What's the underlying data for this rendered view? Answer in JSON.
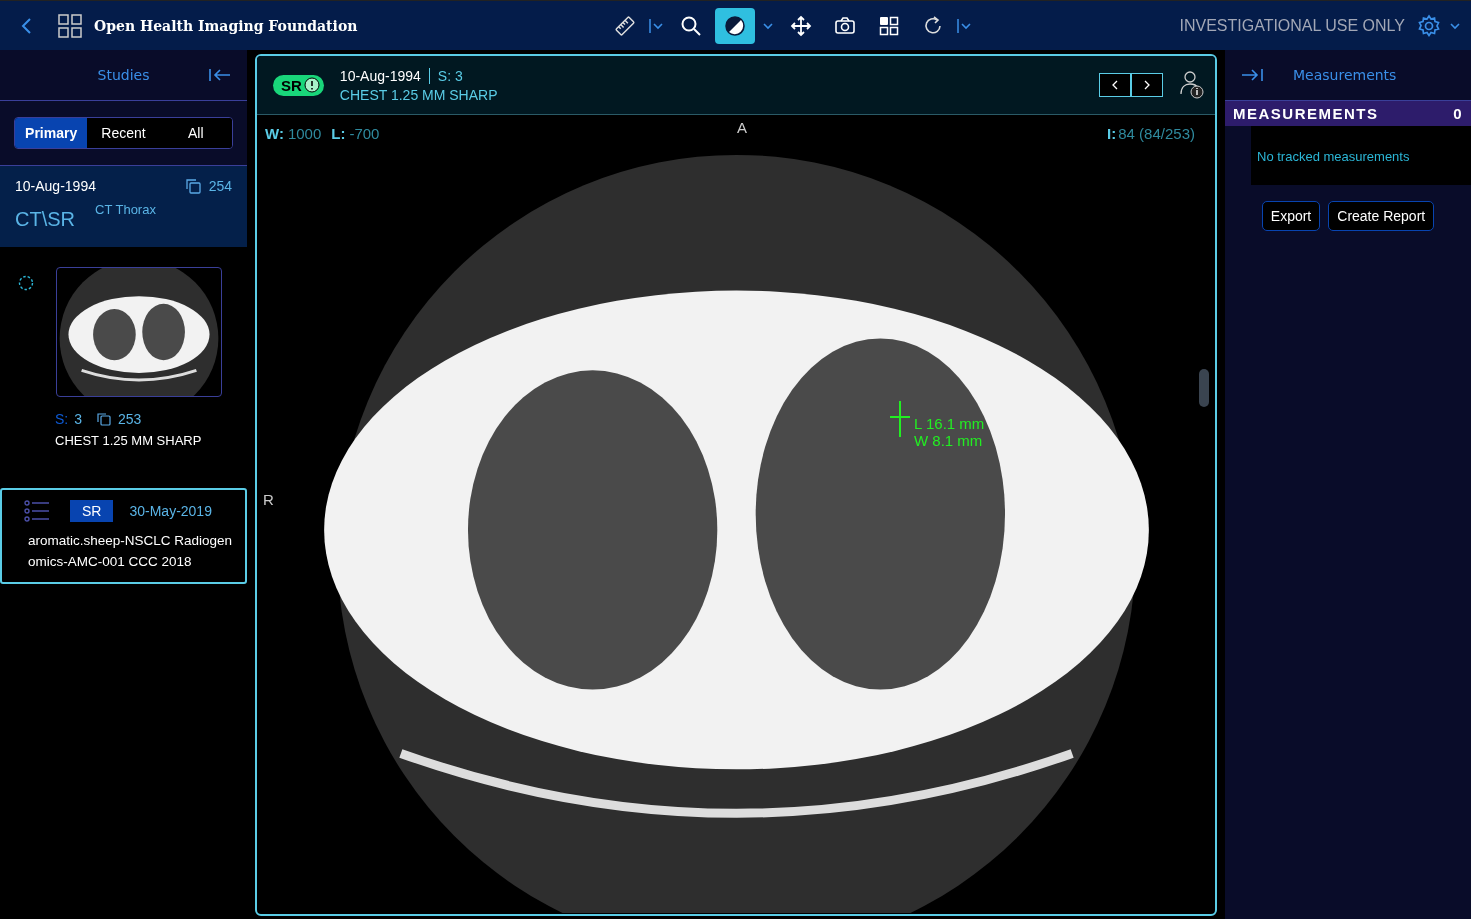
{
  "header": {
    "title": "Open Health Imaging Foundation",
    "notice": "INVESTIGATIONAL USE ONLY",
    "tools": [
      {
        "kind": "ruler",
        "selected": false,
        "dropdown": true
      },
      {
        "kind": "zoom",
        "selected": false,
        "dropdown": false
      },
      {
        "kind": "contrast",
        "selected": true,
        "dropdown": true
      },
      {
        "kind": "pan",
        "selected": false,
        "dropdown": false
      },
      {
        "kind": "camera",
        "selected": false,
        "dropdown": false
      },
      {
        "kind": "layout",
        "selected": false,
        "dropdown": false
      },
      {
        "kind": "rotate",
        "selected": false,
        "dropdown": true
      }
    ]
  },
  "studies_panel": {
    "title": "Studies",
    "tabs": [
      {
        "label": "Primary",
        "selected": true
      },
      {
        "label": "Recent",
        "selected": false
      },
      {
        "label": "All",
        "selected": false
      }
    ],
    "study": {
      "date": "10-Aug-1994",
      "instances": "254",
      "modality": "CT\\SR",
      "description": "CT Thorax"
    },
    "series": [
      {
        "kind": "image",
        "loading": true,
        "selected": false,
        "series_label": "S:",
        "series_number": "3",
        "instances": "253",
        "description": "CHEST 1.25 MM SHARP"
      },
      {
        "kind": "report",
        "selected": true,
        "badge": "SR",
        "date": "30-May-2019",
        "description": "aromatic.sheep-NSCLC Radiogenomics-AMC-001 CCC 2018"
      }
    ]
  },
  "viewport": {
    "badge": "SR",
    "date": "10-Aug-1994",
    "series": "S: 3",
    "description": "CHEST 1.25 MM SHARP",
    "overlay": {
      "window_label": "W:",
      "window": "1000",
      "level_label": "L:",
      "level_value": "-700",
      "image_label": "I:",
      "image": "84 (84/253)",
      "top_marker": "A",
      "left_marker": "R"
    },
    "annotation": {
      "length": "L 16.1 mm",
      "width": "W 8.1 mm"
    }
  },
  "measurements_panel": {
    "title": "Measurements",
    "section": "MEASUREMENTS",
    "count": "0",
    "empty": "No tracked measurements",
    "buttons": [
      "Export",
      "Create Report"
    ]
  }
}
